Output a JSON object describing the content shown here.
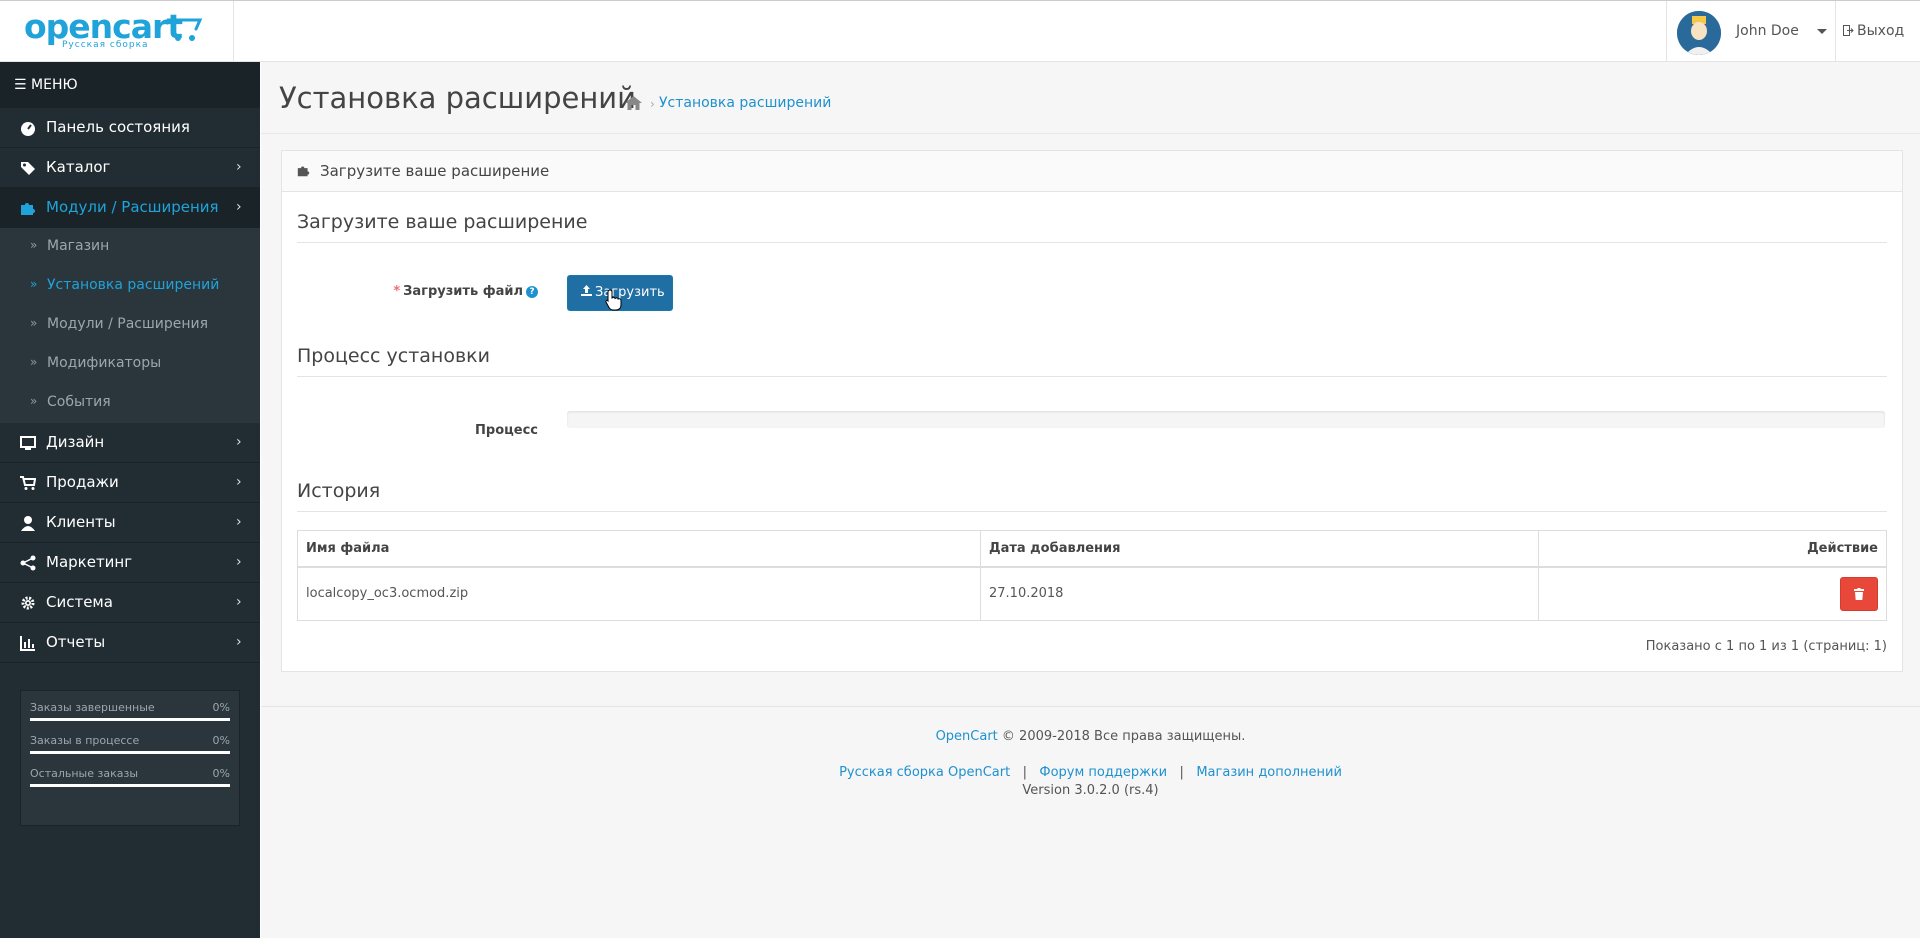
{
  "header": {
    "logo_text": "opencart",
    "logo_sub": "Русская сборка",
    "user_name": "John Doe",
    "logout_label": "Выход"
  },
  "sidebar": {
    "menu_label": "МЕНЮ",
    "items": [
      {
        "label": "Панель состояния",
        "icon": "dashboard-icon"
      },
      {
        "label": "Каталог",
        "icon": "tags-icon"
      },
      {
        "label": "Модули / Расширения",
        "icon": "puzzle-icon",
        "active": true
      },
      {
        "label": "Дизайн",
        "icon": "monitor-icon"
      },
      {
        "label": "Продажи",
        "icon": "cart-icon"
      },
      {
        "label": "Клиенты",
        "icon": "user-icon"
      },
      {
        "label": "Маркетинг",
        "icon": "share-icon"
      },
      {
        "label": "Система",
        "icon": "gear-icon"
      },
      {
        "label": "Отчеты",
        "icon": "bar-chart-icon"
      }
    ],
    "sub_items": [
      {
        "label": "Магазин"
      },
      {
        "label": "Установка расширений",
        "active": true
      },
      {
        "label": "Модули / Расширения"
      },
      {
        "label": "Модификаторы"
      },
      {
        "label": "События"
      }
    ],
    "stats": [
      {
        "label": "Заказы завершенные",
        "value": "0%"
      },
      {
        "label": "Заказы в процессе",
        "value": "0%"
      },
      {
        "label": "Остальные заказы",
        "value": "0%"
      }
    ]
  },
  "page": {
    "title": "Установка расширений",
    "breadcrumb": "Установка расширений",
    "panel_heading": "Загрузите ваше расширение",
    "upload_section": "Загрузите ваше расширение",
    "upload_label": "Загрузить файл",
    "upload_button": "Загрузить",
    "process_section": "Процесс установки",
    "process_label": "Процесс",
    "progress": 0,
    "history_section": "История",
    "table": {
      "headers": [
        "Имя файла",
        "Дата добавления",
        "Действие"
      ],
      "rows": [
        {
          "file": "localcopy_oc3.ocmod.zip",
          "date": "27.10.2018"
        }
      ]
    },
    "pagination": "Показано с 1 по 1 из 1 (страниц: 1)"
  },
  "footer": {
    "brand": "OpenCart",
    "copyright": "© 2009-2018 Все права защищены.",
    "links": [
      "Русская сборка OpenCart",
      "Форум поддержки",
      "Магазин дополнений"
    ],
    "version": "Version 3.0.2.0 (rs.4)"
  },
  "colors": {
    "accent": "#1e91cf",
    "sidebar_bg": "#222d33",
    "danger": "#e8483a"
  }
}
